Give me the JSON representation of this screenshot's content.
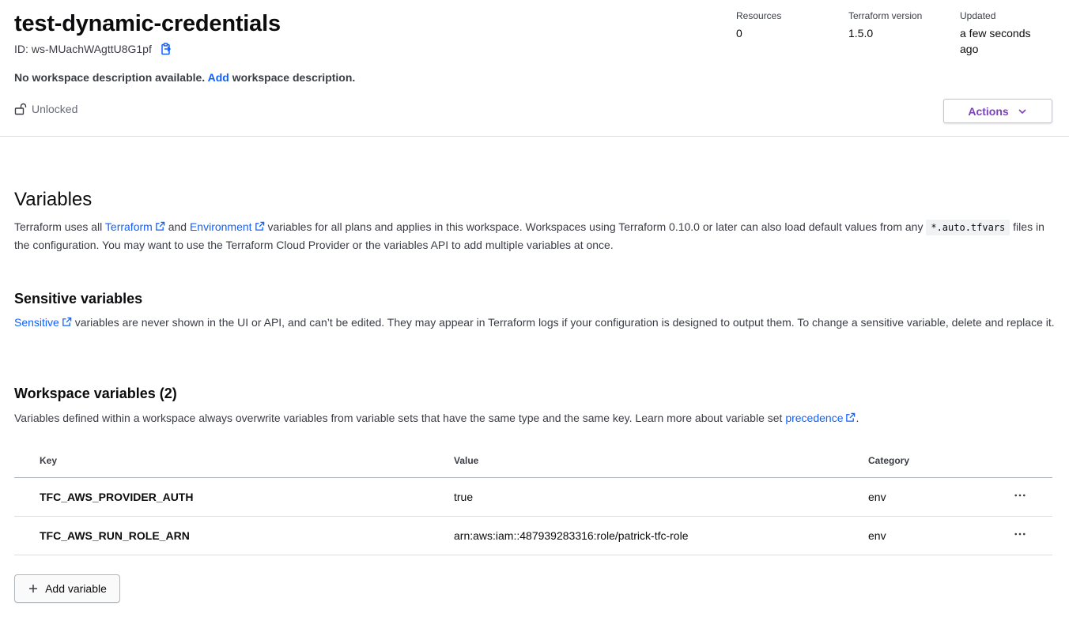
{
  "workspace": {
    "title": "test-dynamic-credentials",
    "id_label": "ID:",
    "id_value": "ws-MUachWAgttU8G1pf",
    "desc_prefix": "No workspace description available.",
    "desc_link": "Add",
    "desc_suffix": "workspace description.",
    "lock_status": "Unlocked"
  },
  "meta": {
    "resources_label": "Resources",
    "resources_value": "0",
    "tf_version_label": "Terraform version",
    "tf_version_value": "1.5.0",
    "updated_label": "Updated",
    "updated_value": "a few seconds ago"
  },
  "actions": {
    "label": "Actions"
  },
  "variables": {
    "title": "Variables",
    "intro_1": "Terraform uses all",
    "intro_link_terraform": "Terraform",
    "intro_2": "and",
    "intro_link_environment": "Environment",
    "intro_3": "variables for all plans and applies in this workspace. Workspaces using Terraform 0.10.0 or later can also load default values from any",
    "intro_code": "*.auto.tfvars",
    "intro_4": "files in the configuration. You may want to use the Terraform Cloud Provider or the variables API to add multiple variables at once."
  },
  "sensitive": {
    "title": "Sensitive variables",
    "link": "Sensitive",
    "text": "variables are never shown in the UI or API, and can’t be edited. They may appear in Terraform logs if your configuration is designed to output them. To change a sensitive variable, delete and replace it."
  },
  "workspace_vars": {
    "title": "Workspace variables (2)",
    "desc_1": "Variables defined within a workspace always overwrite variables from variable sets that have the same type and the same key. Learn more about variable set",
    "desc_link": "precedence",
    "desc_end": ".",
    "columns": {
      "key": "Key",
      "value": "Value",
      "category": "Category"
    },
    "rows": [
      {
        "key": "TFC_AWS_PROVIDER_AUTH",
        "value": "true",
        "category": "env"
      },
      {
        "key": "TFC_AWS_RUN_ROLE_ARN",
        "value": "arn:aws:iam::487939283316:role/patrick-tfc-role",
        "category": "env"
      }
    ],
    "add_label": "Add variable"
  },
  "colors": {
    "link": "#1060ff",
    "actions": "#7b42bc"
  }
}
